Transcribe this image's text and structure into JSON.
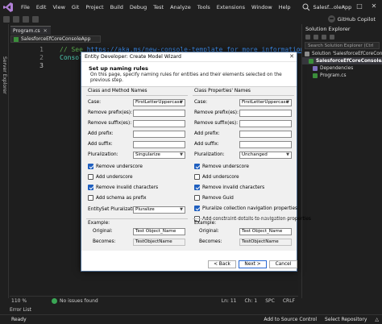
{
  "menubar": {
    "items": [
      "File",
      "Edit",
      "View",
      "Git",
      "Project",
      "Build",
      "Debug",
      "Test",
      "Analyze",
      "Tools",
      "Extensions",
      "Window",
      "Help"
    ],
    "window_title": "Salesf...oleApp"
  },
  "toolbar": {
    "copilot_label": "GitHub Copilot"
  },
  "left_strip": {
    "label": "Server Explorer"
  },
  "editor": {
    "tab_label": "Program.cs",
    "nav_dropdown": "SalesforceEfCoreConsoleApp",
    "line_numbers": [
      "1",
      "2",
      "3"
    ],
    "line1_comment": "// See ",
    "line1_link": "https://aka.ms/new-console-template for more information",
    "line2_code": "Console",
    "zoom": "110 %",
    "status_text": "No issues found",
    "position": {
      "ln": "Ln: 11",
      "ch": "Ch: 1",
      "spc": "SPC",
      "crlf": "CRLF"
    }
  },
  "solution_explorer": {
    "title": "Solution Explorer",
    "search_placeholder": "Search Solution Explorer (Ctrl",
    "items": [
      {
        "label": "Solution 'SalesforceEfCoreConsoleApp'",
        "indent": 0,
        "icon_color": "#8c8c8c",
        "selected": false
      },
      {
        "label": "SalesforceEfCoreConsoleApp",
        "indent": 1,
        "icon_color": "#3b8e3b",
        "selected": true
      },
      {
        "label": "Dependencies",
        "indent": 2,
        "icon_color": "#7f6fbf",
        "selected": false
      },
      {
        "label": "Program.cs",
        "indent": 2,
        "icon_color": "#3b8e3b",
        "selected": false
      }
    ]
  },
  "bottom": {
    "error_list_tab": "Error List",
    "ready": "Ready",
    "source_control": "Add to Source Control",
    "repository": "Select Repository"
  },
  "dialog": {
    "title": "Entity Developer: Create Model Wizard",
    "heading": "Set up naming rules",
    "description": "On this page, specify naming rules for entities and their elements selected on the previous step.",
    "left": {
      "title": "Class and Method Names",
      "case_label": "Case:",
      "case_value": "FirstLetterUppercase",
      "remove_prefix_label": "Remove prefix(es):",
      "remove_suffix_label": "Remove suffix(es):",
      "add_prefix_label": "Add prefix:",
      "add_suffix_label": "Add suffix:",
      "pluralization_label": "Pluralization:",
      "pluralization_value": "Singularize",
      "checkboxes": [
        {
          "label": "Remove underscore",
          "checked": true
        },
        {
          "label": "Add underscore",
          "checked": false
        },
        {
          "label": "Remove invalid characters",
          "checked": true
        },
        {
          "label": "Add schema as prefix",
          "checked": false
        }
      ],
      "entityset_label": "EntitySet Pluralization:",
      "entityset_value": "Pluralize",
      "example_label": "Example:",
      "original_label": "Original:",
      "original_value": "Test Object_Name",
      "becomes_label": "Becomes:",
      "becomes_value": "TestObjectName"
    },
    "right": {
      "title": "Class Properties' Names",
      "case_label": "Case:",
      "case_value": "FirstLetterUppercase",
      "remove_prefix_label": "Remove prefix(es):",
      "remove_suffix_label": "Remove suffix(es):",
      "add_prefix_label": "Add prefix:",
      "add_suffix_label": "Add suffix:",
      "pluralization_label": "Pluralization:",
      "pluralization_value": "Unchanged",
      "checkboxes": [
        {
          "label": "Remove underscore",
          "checked": true
        },
        {
          "label": "Add underscore",
          "checked": false
        },
        {
          "label": "Remove invalid characters",
          "checked": true
        },
        {
          "label": "Remove Guid",
          "checked": false
        },
        {
          "label": "Pluralize collection navigation properties",
          "checked": true
        },
        {
          "label": "Add constraint details to navigation properties",
          "checked": false
        }
      ],
      "example_label": "Example:",
      "original_label": "Original:",
      "original_value": "Test Object_Name",
      "becomes_label": "Becomes:",
      "becomes_value": "TestObjectName"
    },
    "buttons": {
      "back": "< Back",
      "next": "Next >",
      "cancel": "Cancel"
    }
  }
}
